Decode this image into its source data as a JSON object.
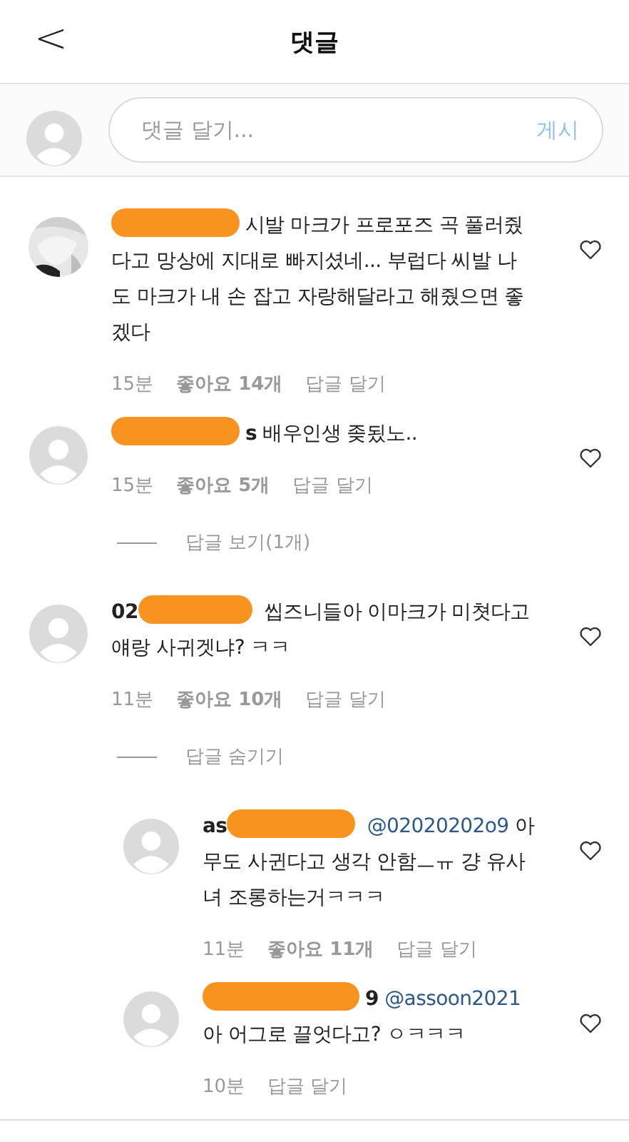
{
  "header": {
    "back": "<",
    "title": "댓글"
  },
  "composer": {
    "placeholder": "댓글 달기...",
    "post": "게시"
  },
  "comments": [
    {
      "photo_avatar": true,
      "redaction_before": true,
      "text": "시발 마크가 프로포즈 곡 풀러줬다고 망상에 지대로 빠지셨네... 부럽다 씨발 나도 마크가 내 손 잡고 자랑해달라고 해줬으면 좋겠다",
      "time": "15분",
      "likes": "좋아요 14개",
      "reply": "답글 달기"
    },
    {
      "photo_avatar": false,
      "redaction_before": true,
      "username": "s",
      "text": "배우인생 좆됬노..",
      "time": "15분",
      "likes": "좋아요 5개",
      "reply": "답글 달기",
      "replies_toggle": "답글 보기(1개)"
    },
    {
      "photo_avatar": false,
      "redaction_before": false,
      "username": "02",
      "text": "씹즈니들아 이마크가 미쳣다고 얘랑 사귀겟냐? ㅋㅋ",
      "time": "11분",
      "likes": "좋아요 10개",
      "reply": "답글 달기",
      "replies_toggle": "답글 숨기기",
      "replies": [
        {
          "photo_avatar": false,
          "redaction_before": false,
          "username": "as",
          "mention": "@02020202o9",
          "text": "아무도 사귄다고 생각 안함ㅡㅠ 걍 유사녀 조롱하는거ㅋㅋㅋ",
          "time": "11분",
          "likes": "좋아요 11개",
          "reply": "답글 달기"
        },
        {
          "photo_avatar": false,
          "redaction_before": true,
          "username": "9",
          "mention": "@assoon2021",
          "text": "아 어그로 끌엇다고? ㅇㅋㅋㅋ",
          "time": "10분",
          "reply": "답글 달기"
        }
      ]
    }
  ]
}
